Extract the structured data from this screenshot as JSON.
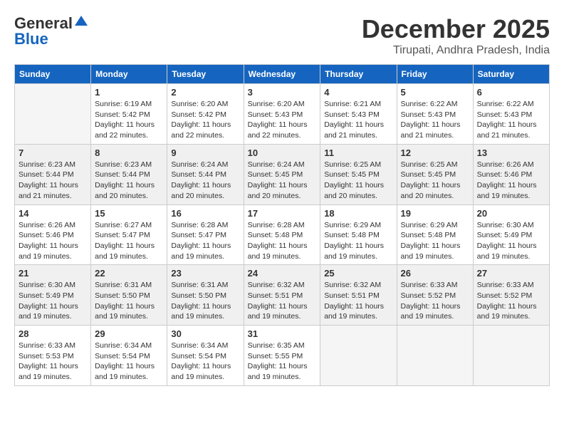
{
  "header": {
    "logo_general": "General",
    "logo_blue": "Blue",
    "month_year": "December 2025",
    "location": "Tirupati, Andhra Pradesh, India"
  },
  "days_of_week": [
    "Sunday",
    "Monday",
    "Tuesday",
    "Wednesday",
    "Thursday",
    "Friday",
    "Saturday"
  ],
  "weeks": [
    [
      {
        "day": "",
        "empty": true
      },
      {
        "day": "1",
        "sunrise": "6:19 AM",
        "sunset": "5:42 PM",
        "daylight": "11 hours and 22 minutes."
      },
      {
        "day": "2",
        "sunrise": "6:20 AM",
        "sunset": "5:42 PM",
        "daylight": "11 hours and 22 minutes."
      },
      {
        "day": "3",
        "sunrise": "6:20 AM",
        "sunset": "5:43 PM",
        "daylight": "11 hours and 22 minutes."
      },
      {
        "day": "4",
        "sunrise": "6:21 AM",
        "sunset": "5:43 PM",
        "daylight": "11 hours and 21 minutes."
      },
      {
        "day": "5",
        "sunrise": "6:22 AM",
        "sunset": "5:43 PM",
        "daylight": "11 hours and 21 minutes."
      },
      {
        "day": "6",
        "sunrise": "6:22 AM",
        "sunset": "5:43 PM",
        "daylight": "11 hours and 21 minutes."
      }
    ],
    [
      {
        "day": "7",
        "sunrise": "6:23 AM",
        "sunset": "5:44 PM",
        "daylight": "11 hours and 21 minutes."
      },
      {
        "day": "8",
        "sunrise": "6:23 AM",
        "sunset": "5:44 PM",
        "daylight": "11 hours and 20 minutes."
      },
      {
        "day": "9",
        "sunrise": "6:24 AM",
        "sunset": "5:44 PM",
        "daylight": "11 hours and 20 minutes."
      },
      {
        "day": "10",
        "sunrise": "6:24 AM",
        "sunset": "5:45 PM",
        "daylight": "11 hours and 20 minutes."
      },
      {
        "day": "11",
        "sunrise": "6:25 AM",
        "sunset": "5:45 PM",
        "daylight": "11 hours and 20 minutes."
      },
      {
        "day": "12",
        "sunrise": "6:25 AM",
        "sunset": "5:45 PM",
        "daylight": "11 hours and 20 minutes."
      },
      {
        "day": "13",
        "sunrise": "6:26 AM",
        "sunset": "5:46 PM",
        "daylight": "11 hours and 19 minutes."
      }
    ],
    [
      {
        "day": "14",
        "sunrise": "6:26 AM",
        "sunset": "5:46 PM",
        "daylight": "11 hours and 19 minutes."
      },
      {
        "day": "15",
        "sunrise": "6:27 AM",
        "sunset": "5:47 PM",
        "daylight": "11 hours and 19 minutes."
      },
      {
        "day": "16",
        "sunrise": "6:28 AM",
        "sunset": "5:47 PM",
        "daylight": "11 hours and 19 minutes."
      },
      {
        "day": "17",
        "sunrise": "6:28 AM",
        "sunset": "5:48 PM",
        "daylight": "11 hours and 19 minutes."
      },
      {
        "day": "18",
        "sunrise": "6:29 AM",
        "sunset": "5:48 PM",
        "daylight": "11 hours and 19 minutes."
      },
      {
        "day": "19",
        "sunrise": "6:29 AM",
        "sunset": "5:48 PM",
        "daylight": "11 hours and 19 minutes."
      },
      {
        "day": "20",
        "sunrise": "6:30 AM",
        "sunset": "5:49 PM",
        "daylight": "11 hours and 19 minutes."
      }
    ],
    [
      {
        "day": "21",
        "sunrise": "6:30 AM",
        "sunset": "5:49 PM",
        "daylight": "11 hours and 19 minutes."
      },
      {
        "day": "22",
        "sunrise": "6:31 AM",
        "sunset": "5:50 PM",
        "daylight": "11 hours and 19 minutes."
      },
      {
        "day": "23",
        "sunrise": "6:31 AM",
        "sunset": "5:50 PM",
        "daylight": "11 hours and 19 minutes."
      },
      {
        "day": "24",
        "sunrise": "6:32 AM",
        "sunset": "5:51 PM",
        "daylight": "11 hours and 19 minutes."
      },
      {
        "day": "25",
        "sunrise": "6:32 AM",
        "sunset": "5:51 PM",
        "daylight": "11 hours and 19 minutes."
      },
      {
        "day": "26",
        "sunrise": "6:33 AM",
        "sunset": "5:52 PM",
        "daylight": "11 hours and 19 minutes."
      },
      {
        "day": "27",
        "sunrise": "6:33 AM",
        "sunset": "5:52 PM",
        "daylight": "11 hours and 19 minutes."
      }
    ],
    [
      {
        "day": "28",
        "sunrise": "6:33 AM",
        "sunset": "5:53 PM",
        "daylight": "11 hours and 19 minutes."
      },
      {
        "day": "29",
        "sunrise": "6:34 AM",
        "sunset": "5:54 PM",
        "daylight": "11 hours and 19 minutes."
      },
      {
        "day": "30",
        "sunrise": "6:34 AM",
        "sunset": "5:54 PM",
        "daylight": "11 hours and 19 minutes."
      },
      {
        "day": "31",
        "sunrise": "6:35 AM",
        "sunset": "5:55 PM",
        "daylight": "11 hours and 19 minutes."
      },
      {
        "day": "",
        "empty": true
      },
      {
        "day": "",
        "empty": true
      },
      {
        "day": "",
        "empty": true
      }
    ]
  ]
}
